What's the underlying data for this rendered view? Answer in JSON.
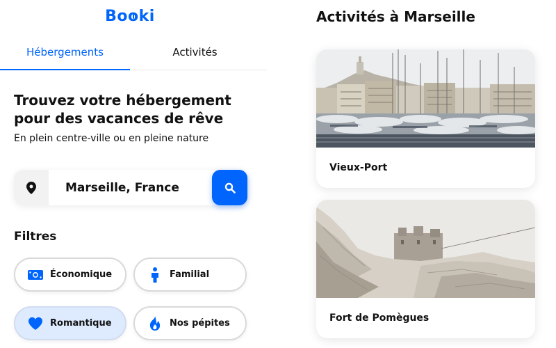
{
  "logo": {
    "text_before": "Bo",
    "text_o": "o",
    "text_after": "ki"
  },
  "tabs": [
    {
      "label": "Hébergements",
      "active": true
    },
    {
      "label": "Activités",
      "active": false
    }
  ],
  "hero": {
    "title": "Trouvez votre hébergement pour des vacances de rêve",
    "subtitle": "En plein centre-ville ou en pleine nature"
  },
  "search": {
    "value": "Marseille, France",
    "pin_icon": "location-pin-icon",
    "button_icon": "search-icon"
  },
  "filters": {
    "title": "Filtres",
    "items": [
      {
        "label": "Économique",
        "icon": "money-icon",
        "selected": false
      },
      {
        "label": "Familial",
        "icon": "person-icon",
        "selected": false
      },
      {
        "label": "Romantique",
        "icon": "heart-icon",
        "selected": true
      },
      {
        "label": "Nos pépites",
        "icon": "fire-icon",
        "selected": false
      }
    ]
  },
  "activities": {
    "title": "Activités à Marseille",
    "cards": [
      {
        "label": "Vieux-Port"
      },
      {
        "label": "Fort de Pomègues"
      }
    ]
  },
  "colors": {
    "primary": "#0065fc",
    "selected_bg": "#deebff"
  }
}
